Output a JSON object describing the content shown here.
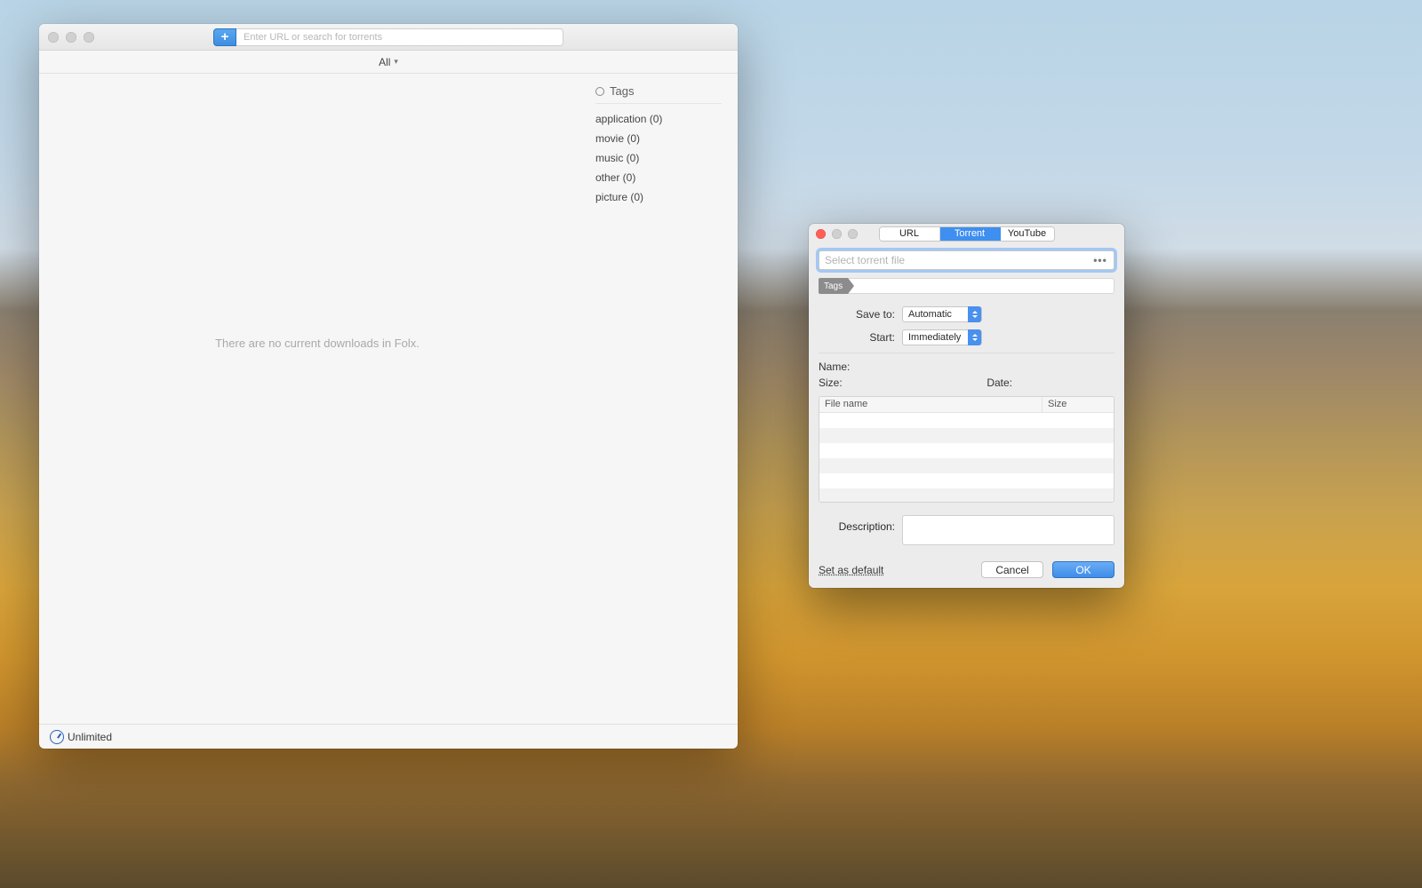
{
  "main": {
    "search_placeholder": "Enter URL or search for torrents",
    "filter_label": "All",
    "empty_message": "There are no current downloads in Folx.",
    "status_label": "Unlimited",
    "tags_header": "Tags",
    "tags": [
      {
        "label": "application (0)"
      },
      {
        "label": "movie (0)"
      },
      {
        "label": "music (0)"
      },
      {
        "label": "other (0)"
      },
      {
        "label": "picture (0)"
      }
    ]
  },
  "dialog": {
    "segments": {
      "url": "URL",
      "torrent": "Torrent",
      "youtube": "YouTube"
    },
    "file_placeholder": "Select torrent file",
    "tags_chip": "Tags",
    "save_to_label": "Save to:",
    "save_to_value": "Automatic",
    "start_label": "Start:",
    "start_value": "Immediately",
    "name_label": "Name:",
    "size_label": "Size:",
    "date_label": "Date:",
    "col_name": "File name",
    "col_size": "Size",
    "description_label": "Description:",
    "set_default": "Set as default",
    "cancel": "Cancel",
    "ok": "OK"
  }
}
